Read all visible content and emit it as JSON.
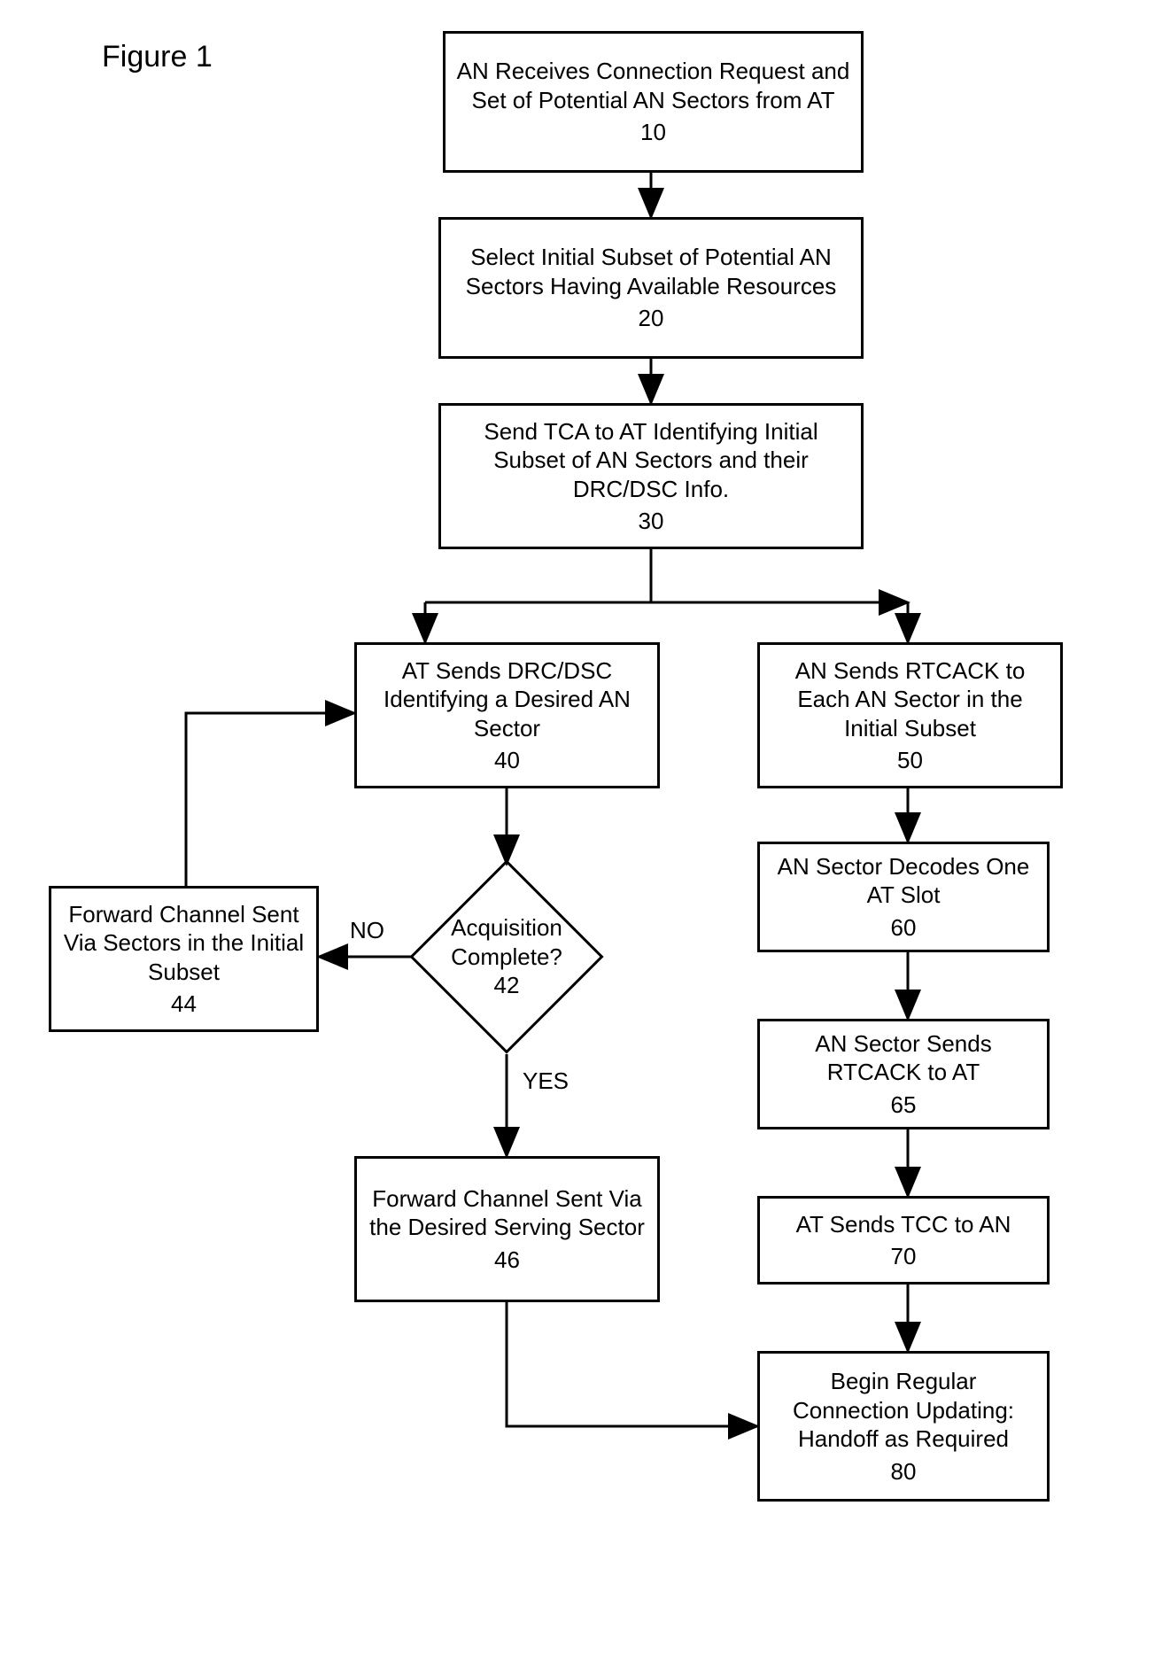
{
  "figure_title": "Figure 1",
  "nodes": {
    "n10": {
      "text": "AN Receives Connection Request and Set of Potential AN Sectors from AT",
      "num": "10"
    },
    "n20": {
      "text": "Select Initial Subset of Potential AN Sectors Having Available Resources",
      "num": "20"
    },
    "n30": {
      "text": "Send TCA to AT Identifying Initial Subset of AN Sectors and their DRC/DSC Info.",
      "num": "30"
    },
    "n40": {
      "text": "AT Sends DRC/DSC Identifying a Desired AN Sector",
      "num": "40"
    },
    "n42": {
      "text": "Acquisition Complete?",
      "num": "42"
    },
    "n44": {
      "text": "Forward Channel Sent Via Sectors in the Initial Subset",
      "num": "44"
    },
    "n46": {
      "text": "Forward Channel Sent Via the Desired Serving Sector",
      "num": "46"
    },
    "n50": {
      "text": "AN Sends RTCACK to Each AN Sector in the Initial Subset",
      "num": "50"
    },
    "n60": {
      "text": "AN Sector Decodes One AT Slot",
      "num": "60"
    },
    "n65": {
      "text": "AN Sector Sends RTCACK to AT",
      "num": "65"
    },
    "n70": {
      "text": "AT Sends TCC to AN",
      "num": "70"
    },
    "n80": {
      "text": "Begin Regular Connection Updating: Handoff as Required",
      "num": "80"
    }
  },
  "labels": {
    "no": "NO",
    "yes": "YES"
  }
}
